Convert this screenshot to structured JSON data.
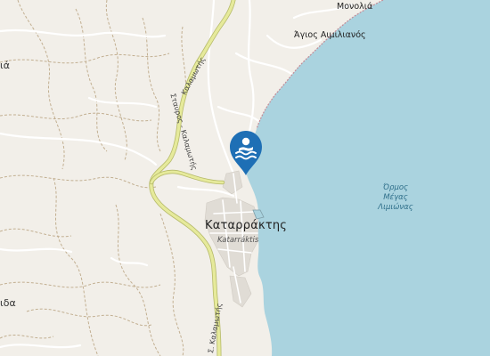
{
  "map": {
    "colors": {
      "land": "#f2efe9",
      "sea": "#aad3df",
      "coast": "#c28b97",
      "road_primary": "#e6ea9b",
      "road_casing": "#b6ba6a",
      "track": "#b29a74",
      "minor_road": "#ffffff",
      "marker": "#1e6fb5"
    },
    "labels": {
      "village_monolia": "Μονολιά",
      "village_agios_aimilianos": "Άγιος Αιμιλιανός",
      "town_katarraktis": "Καταρράκτης",
      "town_katarraktis_latin": "Katarráktis",
      "bay_line1": "Όρμος",
      "bay_line2": "Μέγας",
      "bay_line3": "Λιμιώνας",
      "road_upper": "Καλαμωτής",
      "road_middle": "Σταυρος - Καλαμωτής",
      "road_lower": "Σ. Καλαμωτής",
      "edge_left_top": "ιά",
      "edge_left_bottom": "ιδα"
    },
    "marker": {
      "icon": "swimming-icon"
    }
  }
}
